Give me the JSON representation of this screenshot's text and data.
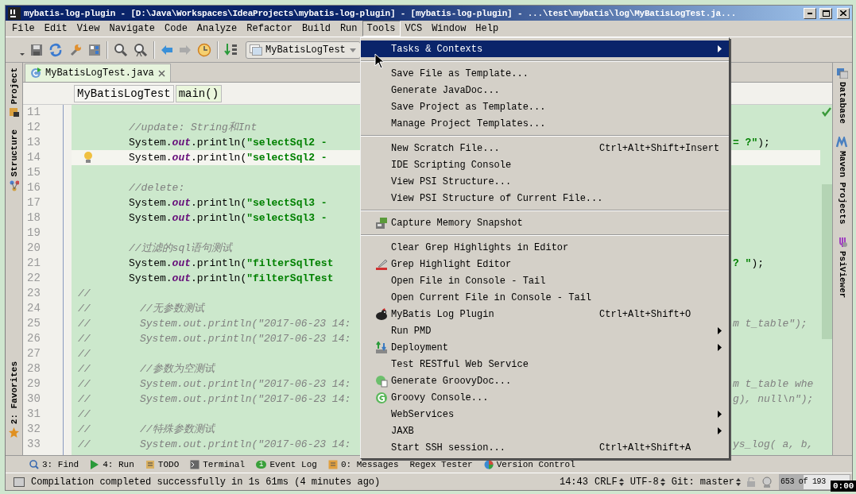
{
  "window": {
    "title": "mybatis-log-plugin - [D:\\Java\\Workspaces\\IdeaProjects\\mybatis-log-plugin] - [mybatis-log-plugin] - ...\\test\\mybatis\\log\\MyBatisLogTest.ja..."
  },
  "menu_bar": [
    {
      "label": "File",
      "selected": false
    },
    {
      "label": "Edit",
      "selected": false
    },
    {
      "label": "View",
      "selected": false
    },
    {
      "label": "Navigate",
      "selected": false
    },
    {
      "label": "Code",
      "selected": false
    },
    {
      "label": "Analyze",
      "selected": false
    },
    {
      "label": "Refactor",
      "selected": false
    },
    {
      "label": "Build",
      "selected": false
    },
    {
      "label": "Run",
      "selected": false
    },
    {
      "label": "Tools",
      "selected": true
    },
    {
      "label": "VCS",
      "selected": false
    },
    {
      "label": "Window",
      "selected": false
    },
    {
      "label": "Help",
      "selected": false
    }
  ],
  "toolbar": {
    "run_config": "MyBatisLogTest"
  },
  "left_strip": {
    "top": [
      {
        "label": "Project",
        "kind": "project"
      },
      {
        "label": "Structure",
        "kind": "structure"
      }
    ],
    "bottom": [
      {
        "label": "2: Favorites",
        "kind": "favorites"
      }
    ]
  },
  "editor_tabs": [
    {
      "label": "MyBatisLogTest.java",
      "selected": true
    }
  ],
  "breadcrumbs": [
    {
      "label": "MyBatisLogTest",
      "selected": false
    },
    {
      "label": "main()",
      "selected": true
    }
  ],
  "code_lines": [
    {
      "number": "11",
      "kind": "flush",
      "current": false,
      "intention_bulb": false
    },
    {
      "number": "12",
      "kind": "indented",
      "current": false,
      "intention_bulb": false,
      "segments": [
        {
          "kind": "comment",
          "text": "//update: String和Int"
        }
      ]
    },
    {
      "number": "13",
      "kind": "indented",
      "current": false,
      "intention_bulb": false,
      "segments": [
        {
          "kind": "plain",
          "text": "System."
        },
        {
          "kind": "field",
          "text": "out"
        },
        {
          "kind": "plain",
          "text": ".println("
        },
        {
          "kind": "string",
          "text": "\"selectSql2 -"
        }
      ],
      "tail": [
        {
          "kind": "string",
          "text": "= ?\""
        },
        {
          "kind": "plain",
          "text": ");"
        }
      ]
    },
    {
      "number": "14",
      "kind": "indented",
      "current": true,
      "intention_bulb": true,
      "segments": [
        {
          "kind": "plain",
          "text": "System."
        },
        {
          "kind": "field",
          "text": "out"
        },
        {
          "kind": "plain",
          "text": ".println("
        },
        {
          "kind": "string",
          "text": "\"selectSql2 -"
        }
      ]
    },
    {
      "number": "15",
      "kind": "flush",
      "current": false,
      "intention_bulb": false
    },
    {
      "number": "16",
      "kind": "indented",
      "current": false,
      "intention_bulb": false,
      "segments": [
        {
          "kind": "comment",
          "text": "//delete:"
        }
      ]
    },
    {
      "number": "17",
      "kind": "indented",
      "current": false,
      "intention_bulb": false,
      "segments": [
        {
          "kind": "plain",
          "text": "System."
        },
        {
          "kind": "field",
          "text": "out"
        },
        {
          "kind": "plain",
          "text": ".println("
        },
        {
          "kind": "string",
          "text": "\"selectSql3 -"
        }
      ]
    },
    {
      "number": "18",
      "kind": "indented",
      "current": false,
      "intention_bulb": false,
      "segments": [
        {
          "kind": "plain",
          "text": "System."
        },
        {
          "kind": "field",
          "text": "out"
        },
        {
          "kind": "plain",
          "text": ".println("
        },
        {
          "kind": "string",
          "text": "\"selectSql3 -"
        }
      ]
    },
    {
      "number": "19",
      "kind": "flush",
      "current": false,
      "intention_bulb": false
    },
    {
      "number": "20",
      "kind": "indented",
      "current": false,
      "intention_bulb": false,
      "segments": [
        {
          "kind": "comment",
          "text": "//过滤的sql语句测试"
        }
      ]
    },
    {
      "number": "21",
      "kind": "indented",
      "current": false,
      "intention_bulb": false,
      "segments": [
        {
          "kind": "plain",
          "text": "System."
        },
        {
          "kind": "field",
          "text": "out"
        },
        {
          "kind": "plain",
          "text": ".println("
        },
        {
          "kind": "string",
          "text": "\"filterSqlTest"
        }
      ],
      "tail": [
        {
          "kind": "string",
          "text": "? \""
        },
        {
          "kind": "plain",
          "text": ");"
        }
      ]
    },
    {
      "number": "22",
      "kind": "indented",
      "current": false,
      "intention_bulb": false,
      "segments": [
        {
          "kind": "plain",
          "text": "System."
        },
        {
          "kind": "field",
          "text": "out"
        },
        {
          "kind": "plain",
          "text": ".println("
        },
        {
          "kind": "string",
          "text": "\"filterSqlTest"
        }
      ]
    },
    {
      "number": "23",
      "kind": "flush",
      "current": false,
      "intention_bulb": false,
      "segments": [
        {
          "kind": "comment",
          "text": "//"
        }
      ]
    },
    {
      "number": "24",
      "kind": "flush",
      "current": false,
      "intention_bulb": false,
      "segments": [
        {
          "kind": "comment",
          "text": "//        //无参数测试"
        }
      ]
    },
    {
      "number": "25",
      "kind": "flush",
      "current": false,
      "intention_bulb": false,
      "segments": [
        {
          "kind": "comment",
          "text": "//        System.out.println(\"2017-06-23 14:"
        }
      ],
      "tail": [
        {
          "kind": "comment",
          "text": "m t_table\");"
        }
      ]
    },
    {
      "number": "26",
      "kind": "flush",
      "current": false,
      "intention_bulb": false,
      "segments": [
        {
          "kind": "comment",
          "text": "//        System.out.println(\"2017-06-23 14:"
        }
      ]
    },
    {
      "number": "27",
      "kind": "flush",
      "current": false,
      "intention_bulb": false,
      "segments": [
        {
          "kind": "comment",
          "text": "//"
        }
      ]
    },
    {
      "number": "28",
      "kind": "flush",
      "current": false,
      "intention_bulb": false,
      "segments": [
        {
          "kind": "comment",
          "text": "//        //参数为空测试"
        }
      ]
    },
    {
      "number": "29",
      "kind": "flush",
      "current": false,
      "intention_bulb": false,
      "segments": [
        {
          "kind": "comment",
          "text": "//        System.out.println(\"2017-06-23 14:"
        }
      ],
      "tail": [
        {
          "kind": "comment",
          "text": "m t_table whe"
        }
      ]
    },
    {
      "number": "30",
      "kind": "flush",
      "current": false,
      "intention_bulb": false,
      "segments": [
        {
          "kind": "comment",
          "text": "//        System.out.println(\"2017-06-23 14:"
        }
      ],
      "tail": [
        {
          "kind": "comment",
          "text": "g), null\\n\");"
        }
      ]
    },
    {
      "number": "31",
      "kind": "flush",
      "current": false,
      "intention_bulb": false,
      "segments": [
        {
          "kind": "comment",
          "text": "//"
        }
      ]
    },
    {
      "number": "32",
      "kind": "flush",
      "current": false,
      "intention_bulb": false,
      "segments": [
        {
          "kind": "comment",
          "text": "//        //特殊参数测试"
        }
      ]
    },
    {
      "number": "33",
      "kind": "flush",
      "current": false,
      "intention_bulb": false,
      "segments": [
        {
          "kind": "comment",
          "text": "//        System.out.println(\"2017-06-23 14:"
        }
      ],
      "tail": [
        {
          "kind": "comment",
          "text": "ys_log( a, b,"
        }
      ]
    }
  ],
  "tools_menu": [
    {
      "kind": "item",
      "label": "Tasks & Contexts",
      "submenu": true,
      "selected": true
    },
    {
      "kind": "separator"
    },
    {
      "kind": "item",
      "label": "Save File as Template...",
      "submenu": false,
      "selected": false
    },
    {
      "kind": "item",
      "label": "Generate JavaDoc...",
      "submenu": false,
      "selected": false
    },
    {
      "kind": "item",
      "label": "Save Project as Template...",
      "submenu": false,
      "selected": false
    },
    {
      "kind": "item",
      "label": "Manage Project Templates...",
      "submenu": false,
      "selected": false
    },
    {
      "kind": "separator"
    },
    {
      "kind": "item",
      "label": "New Scratch File...",
      "shortcut": "Ctrl+Alt+Shift+Insert",
      "submenu": false,
      "selected": false
    },
    {
      "kind": "item",
      "label": "IDE Scripting Console",
      "submenu": false,
      "selected": false
    },
    {
      "kind": "item",
      "label": "View PSI Structure...",
      "submenu": false,
      "selected": false
    },
    {
      "kind": "item",
      "label": "View PSI Structure of Current File...",
      "submenu": false,
      "selected": false
    },
    {
      "kind": "separator"
    },
    {
      "kind": "memory",
      "label": "Capture Memory Snapshot",
      "submenu": false,
      "selected": false
    },
    {
      "kind": "separator"
    },
    {
      "kind": "item",
      "label": "Clear Grep Highlights in Editor",
      "submenu": false,
      "selected": false
    },
    {
      "kind": "grep",
      "label": "Grep Highlight Editor",
      "submenu": false,
      "selected": false
    },
    {
      "kind": "item",
      "label": "Open File in Console - Tail",
      "submenu": false,
      "selected": false
    },
    {
      "kind": "item",
      "label": "Open Current File in Console - Tail",
      "submenu": false,
      "selected": false
    },
    {
      "kind": "bird",
      "label": "MyBatis Log Plugin",
      "shortcut": "Ctrl+Alt+Shift+O",
      "submenu": false,
      "selected": false
    },
    {
      "kind": "item",
      "label": "Run PMD",
      "submenu": true,
      "selected": false
    },
    {
      "kind": "deployment",
      "label": "Deployment",
      "submenu": true,
      "selected": false
    },
    {
      "kind": "item",
      "label": "Test RESTful Web Service",
      "submenu": false,
      "selected": false
    },
    {
      "kind": "groovydoc",
      "label": "Generate GroovyDoc...",
      "submenu": false,
      "selected": false
    },
    {
      "kind": "groovy",
      "label": "Groovy Console...",
      "submenu": false,
      "selected": false
    },
    {
      "kind": "item",
      "label": "WebServices",
      "submenu": true,
      "selected": false
    },
    {
      "kind": "item",
      "label": "JAXB",
      "submenu": true,
      "selected": false
    },
    {
      "kind": "item",
      "label": "Start SSH session...",
      "shortcut": "Ctrl+Alt+Shift+A",
      "submenu": false,
      "selected": false
    }
  ],
  "right_strip": [
    {
      "label": "Database",
      "kind": "database"
    },
    {
      "label": "Maven Projects",
      "kind": "maven"
    },
    {
      "label": "PsiViewer",
      "kind": "psi"
    }
  ],
  "tool_windows": [
    {
      "label": "3: Find",
      "kind": "find"
    },
    {
      "label": "4: Run",
      "kind": "run"
    },
    {
      "label": "TODO",
      "kind": "todo"
    },
    {
      "label": "Terminal",
      "kind": "terminal"
    },
    {
      "label": "Event Log",
      "kind": "eventlog",
      "badge": "1"
    },
    {
      "label": "0: Messages",
      "kind": "messages"
    },
    {
      "label": "Regex Tester",
      "kind": "none"
    },
    {
      "label": "Version Control",
      "kind": "vcs"
    }
  ],
  "status_bar": {
    "message": "Compilation completed successfully in 1s 61ms (4 minutes ago)",
    "position": "14:43",
    "line_separator": "CRLF",
    "encoding": "UTF-8",
    "vcs": "Git: master",
    "memory": {
      "text": "653 of 193",
      "level": 0.34
    }
  },
  "recorder_timer": "0:00"
}
